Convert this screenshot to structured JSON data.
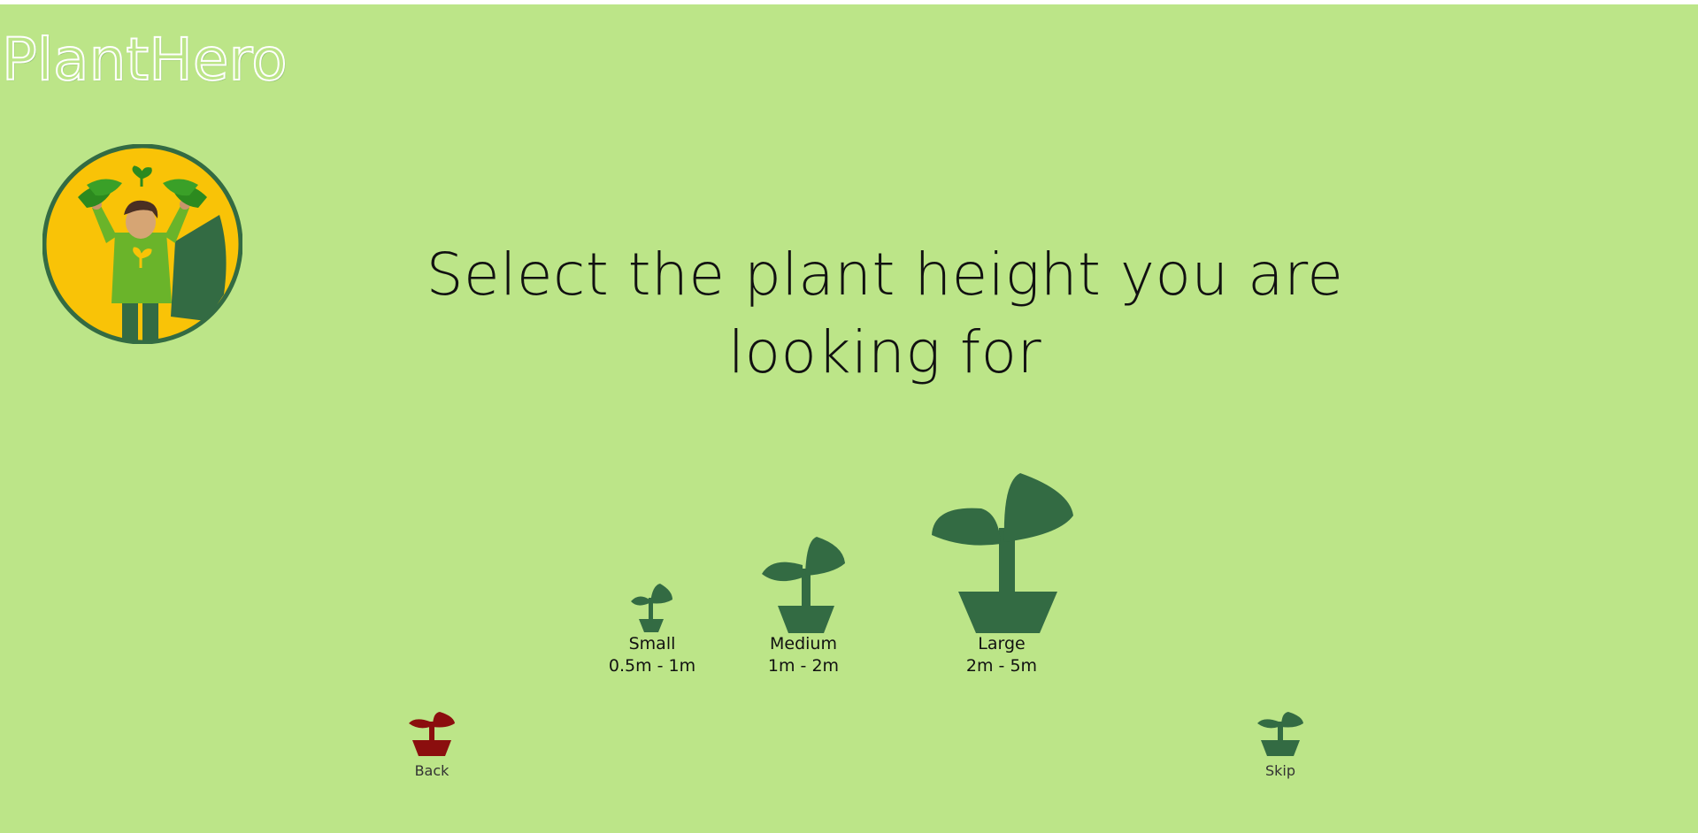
{
  "app": {
    "title": "PlantHero"
  },
  "colors": {
    "background": "#bce588",
    "plant_green": "#336b43",
    "back_red": "#8b0e0e",
    "avatar_yellow": "#f9c307"
  },
  "question": {
    "text": "Select the plant height you are looking for"
  },
  "options": [
    {
      "label": "Small",
      "range": "0.5m - 1m",
      "icon": "small-plant-icon"
    },
    {
      "label": "Medium",
      "range": "1m - 2m",
      "icon": "medium-plant-icon"
    },
    {
      "label": "Large",
      "range": "2m - 5m",
      "icon": "large-plant-icon"
    }
  ],
  "nav": {
    "back_label": "Back",
    "skip_label": "Skip"
  }
}
